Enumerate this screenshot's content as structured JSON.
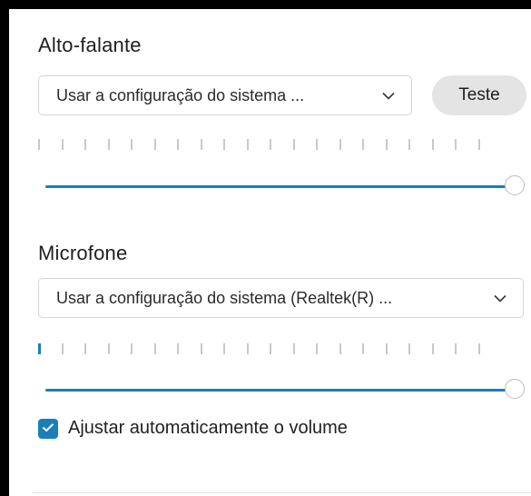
{
  "speaker": {
    "title": "Alto-falante",
    "device": "Usar a configuração do sistema ...",
    "test_label": "Teste",
    "meter_level": 0.0,
    "volume": 1.0
  },
  "microphone": {
    "title": "Microfone",
    "device": "Usar a configuração do sistema (Realtek(R) ...",
    "meter_level": 0.05,
    "volume": 1.0
  },
  "auto_volume": {
    "label": "Ajustar automaticamente o volume",
    "checked": true
  },
  "colors": {
    "accent": "#1a7fb8",
    "inactive_tick": "#c9c9c9"
  },
  "icons": {
    "dropdown": "chevron-down-icon",
    "checkbox": "checkmark-icon"
  }
}
